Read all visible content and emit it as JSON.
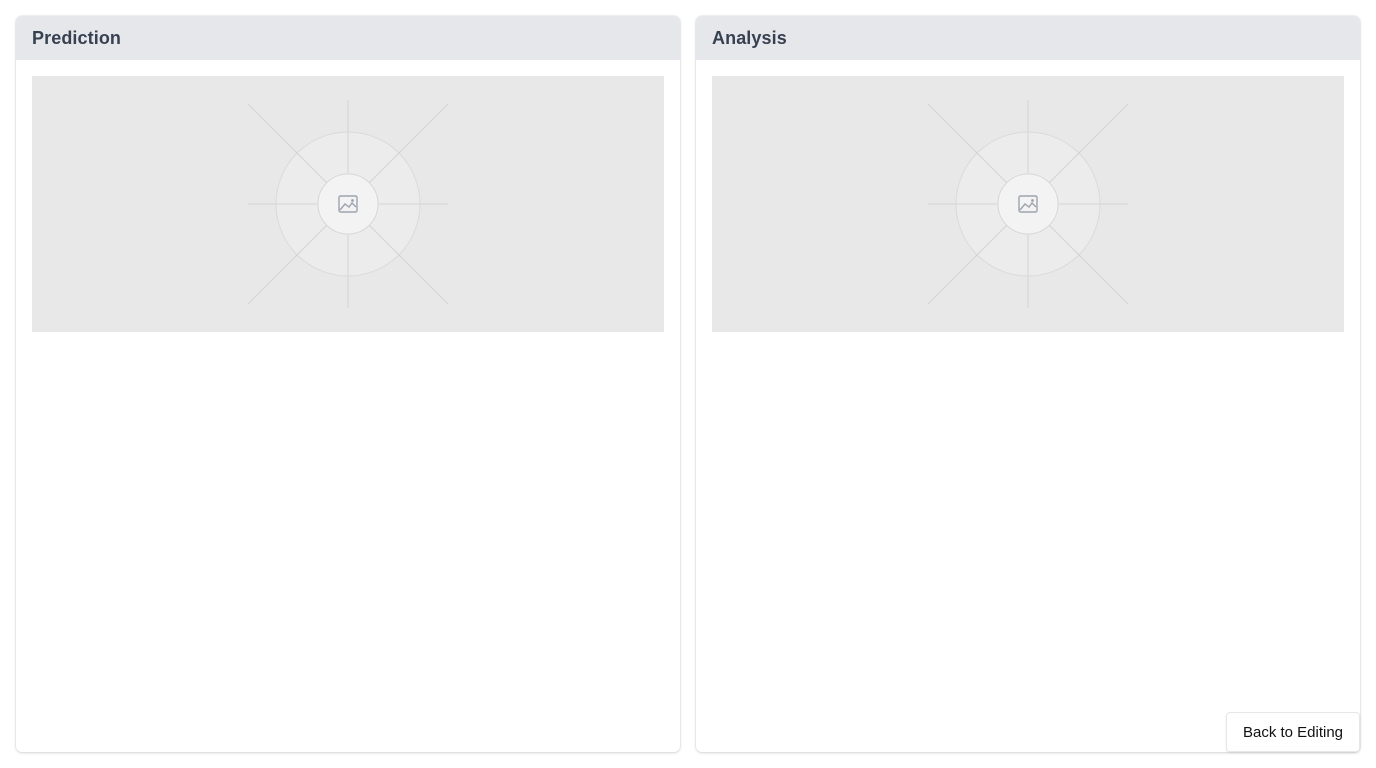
{
  "panels": {
    "prediction": {
      "title": "Prediction",
      "placeholder_icon": "image-icon"
    },
    "analysis": {
      "title": "Analysis",
      "placeholder_icon": "image-icon"
    }
  },
  "actions": {
    "back_label": "Back to Editing"
  },
  "colors": {
    "header_bg": "#e5e7eb",
    "title_text": "#374151",
    "placeholder_bg": "#e8e8e8"
  }
}
